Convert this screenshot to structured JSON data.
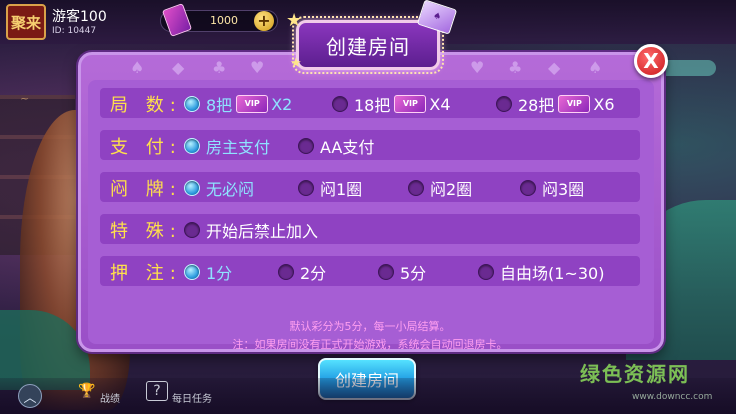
{
  "top_bar": {
    "avatar_text": "聚来",
    "username": "游客100",
    "user_id": "ID: 10447",
    "room_cards": "1000",
    "add_label": "+"
  },
  "dialog": {
    "title": "创建房间",
    "close_label": "X",
    "vip_badge": "VIP",
    "rounds": {
      "label": "局 数:",
      "options": [
        {
          "text": "8把",
          "multiplier": "X2",
          "selected": true
        },
        {
          "text": "18把",
          "multiplier": "X4",
          "selected": false
        },
        {
          "text": "28把",
          "multiplier": "X6",
          "selected": false
        }
      ]
    },
    "payment": {
      "label": "支 付:",
      "options": [
        {
          "text": "房主支付",
          "selected": true
        },
        {
          "text": "AA支付",
          "selected": false
        }
      ]
    },
    "blind": {
      "label": "闷 牌:",
      "options": [
        {
          "text": "无必闷",
          "selected": true
        },
        {
          "text": "闷1圈",
          "selected": false
        },
        {
          "text": "闷2圈",
          "selected": false
        },
        {
          "text": "闷3圈",
          "selected": false
        }
      ]
    },
    "special": {
      "label": "特 殊:",
      "options": [
        {
          "text": "开始后禁止加入",
          "selected": false
        }
      ]
    },
    "bet": {
      "label": "押 注:",
      "options": [
        {
          "text": "1分",
          "selected": true
        },
        {
          "text": "2分",
          "selected": false
        },
        {
          "text": "5分",
          "selected": false
        },
        {
          "text": "自由场(1~30)",
          "selected": false
        }
      ]
    },
    "note_1": "默认彩分为5分，每一小局结算。",
    "note_2": "注：如果房间没有正式开始游戏，系统会自动回退房卡。",
    "create_button": "创建房间"
  },
  "bottom_bar": {
    "record_label": "战绩",
    "daily_task_label": "每日任务"
  },
  "watermark": {
    "text": "绿色资源网",
    "url": "www.downcc.com"
  },
  "colors": {
    "label_yellow": "#ffe04b",
    "selected_blue": "#8fe3ff",
    "dialog_purple": "#a65ed4",
    "note_pink": "#ff9ef0"
  }
}
